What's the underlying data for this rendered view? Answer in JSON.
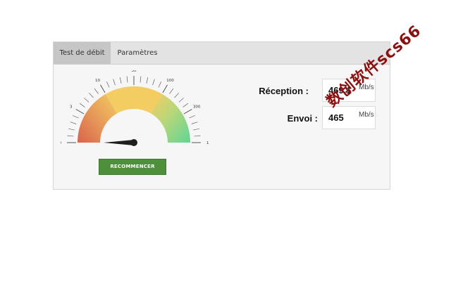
{
  "tabs": [
    {
      "label": "Test de débit",
      "active": true
    },
    {
      "label": "Paramètres",
      "active": false
    }
  ],
  "gauge": {
    "tick_labels": [
      "0",
      "3",
      "10",
      "30",
      "100",
      "300",
      "1000"
    ],
    "zones": [
      {
        "from": "0",
        "to": "10",
        "color": "#d9634c"
      },
      {
        "from": "10",
        "to": "100",
        "color": "#f3cd62"
      },
      {
        "from": "100",
        "to": "1000",
        "color": "#5fd596"
      }
    ],
    "needle_value_mbps": 0,
    "needle_color": "#1e1e1e"
  },
  "restart_button": {
    "label": "RECOMMENCER",
    "color": "#4d8f3a"
  },
  "reception": {
    "label": "Réception :",
    "value": "469,1",
    "unit": "Mb/s"
  },
  "upload": {
    "label": "Envoi :",
    "value": "465",
    "unit": "Mb/s"
  },
  "watermark": {
    "text": "数创软件scs66",
    "color": "#8b1010"
  }
}
